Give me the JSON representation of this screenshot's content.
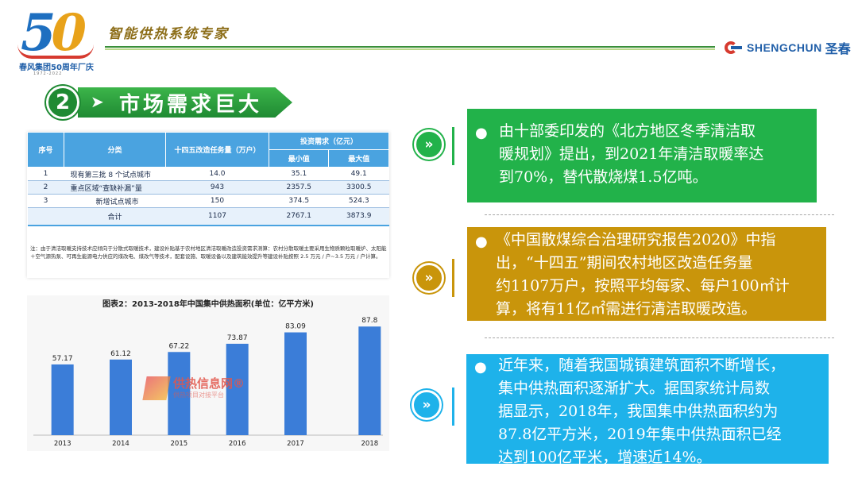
{
  "header": {
    "logo_number": "50",
    "logo_caption": "春风集团50周年厂庆",
    "logo_years": "1972-2022",
    "slogan": "智能供热系统专家",
    "brand_en": "SHENGCHUN",
    "brand_cn": "圣春"
  },
  "section": {
    "number": "2",
    "arrow": "➤",
    "title": "市场需求巨大"
  },
  "table": {
    "headers": {
      "index": "序号",
      "category": "分类",
      "task": "十四五改造任务量（万户）",
      "invest": "投资需求（亿元）",
      "min": "最小值",
      "max": "最大值"
    },
    "rows": [
      {
        "index": "1",
        "category": "现有第三批 8 个试点城市",
        "task": "14.0",
        "min": "35.1",
        "max": "49.1"
      },
      {
        "index": "2",
        "category": "重点区域“查缺补漏”量",
        "task": "943",
        "min": "2357.5",
        "max": "3300.5"
      },
      {
        "index": "3",
        "category": "新增试点城市",
        "task": "150",
        "min": "374.5",
        "max": "524.3"
      }
    ],
    "total": {
      "label": "合计",
      "task": "1107",
      "min": "2767.1",
      "max": "3873.9"
    },
    "note": "注：由于清洁取暖支持技术应倾向于分散式取暖技术，建设补贴基于农村地区清洁取暖改造投资需求测算：农村分散取暖主要采用生物质颗粒取暖炉、太阳能＋空气源热泵、可再生能源电力供应的煤改电、煤改气等技术，配套设施、取暖设备以及建筑能效提升等建设补贴按照 2.5 万元 / 户~3.5 万元 / 户计算。"
  },
  "chart_data": {
    "type": "bar",
    "title": "图表2：2013-2018年中国集中供热面积(单位：亿平方米)",
    "categories": [
      "2013",
      "2014",
      "2015",
      "2016",
      "2017",
      "2018"
    ],
    "values": [
      57.17,
      61.12,
      67.22,
      73.87,
      83.09,
      87.8
    ],
    "value_labels": [
      "57.17",
      "61.12",
      "67.22",
      "73.87",
      "83.09",
      "87.8"
    ],
    "ylim": [
      0,
      95
    ],
    "color": "#3b7dd8",
    "grid": false,
    "watermark": {
      "name": "供热信息网®",
      "sub": "供热项目对接平台"
    }
  },
  "panels": [
    {
      "bullet": "●",
      "text": [
        "由十部委印发的《北方地区冬季清洁取",
        "暖规划》提出，到2021年清洁取暖率达",
        "到70%，替代散烧煤1.5亿吨。"
      ],
      "badge": "»"
    },
    {
      "bullet": "●",
      "text": [
        "《中国散煤综合治理研究报告2020》中指",
        "出，“十四五”期间农村地区改造任务量",
        "约1107万户，按照平均每家、每户100㎡计",
        "算，将有11亿㎡需进行清洁取暖改造。"
      ],
      "badge": "»"
    },
    {
      "bullet": "●",
      "text": [
        "近年来，随着我国城镇建筑面积不断增长，",
        "集中供热面积逐渐扩大。据国家统计局数",
        "据显示，2018年，我国集中供热面积约为",
        "87.8亿平方米，2019年集中供热面积已经",
        "达到100亿平米，增速近14%。"
      ],
      "badge": "»"
    }
  ],
  "colors": {
    "green": "#22b24a",
    "gold": "#c9950b",
    "blue": "#1eb2ea",
    "table_header": "#4aa3e0",
    "brand": "#1f5ea8"
  }
}
